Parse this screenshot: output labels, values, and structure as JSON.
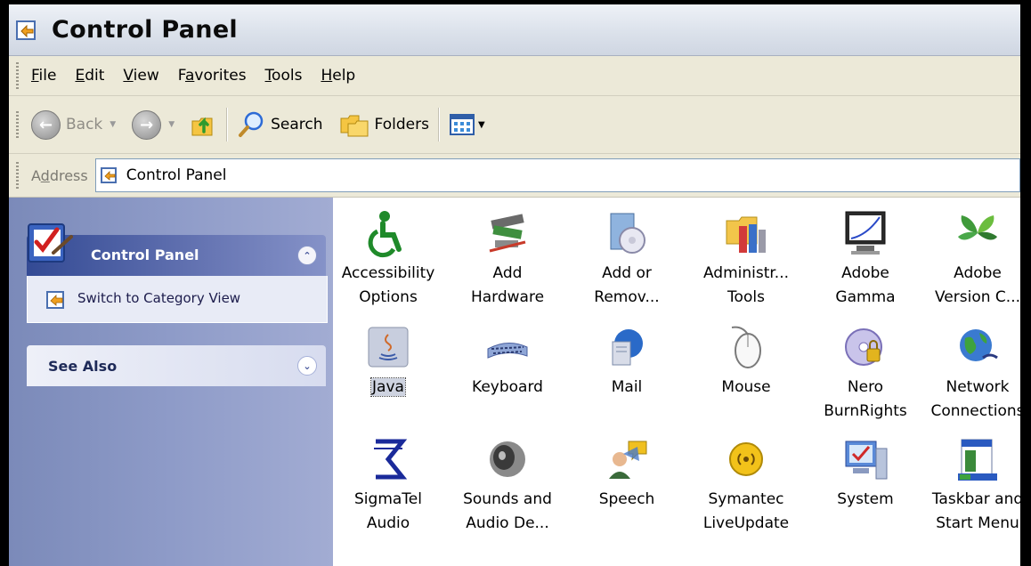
{
  "window": {
    "title": "Control Panel"
  },
  "menu": [
    {
      "label": "File",
      "key": "F",
      "rest": "ile"
    },
    {
      "label": "Edit",
      "key": "E",
      "rest": "dit"
    },
    {
      "label": "View",
      "key": "V",
      "rest": "iew"
    },
    {
      "label": "Favorites",
      "pre": "F",
      "key": "a",
      "rest": "vorites"
    },
    {
      "label": "Tools",
      "key": "T",
      "rest": "ools"
    },
    {
      "label": "Help",
      "key": "H",
      "rest": "elp"
    }
  ],
  "toolbar": {
    "back_label": "Back",
    "search_label": "Search",
    "folders_label": "Folders"
  },
  "address": {
    "label_pre": "A",
    "label_key": "d",
    "label_rest": "dress",
    "value": "Control Panel"
  },
  "taskpane": {
    "control_panel_title": "Control Panel",
    "switch_view_label": "Switch to Category View",
    "see_also_title": "See Also"
  },
  "items": [
    {
      "line1": "Accessibility",
      "line2": "Options",
      "icon": "accessibility-icon"
    },
    {
      "line1": "Add",
      "line2": "Hardware",
      "icon": "add-hardware-icon"
    },
    {
      "line1": "Add or",
      "line2": "Remov...",
      "icon": "add-remove-programs-icon"
    },
    {
      "line1": "Administr...",
      "line2": "Tools",
      "icon": "administrative-tools-icon"
    },
    {
      "line1": "Adobe",
      "line2": "Gamma",
      "icon": "adobe-gamma-icon"
    },
    {
      "line1": "Adobe",
      "line2": "Version C...",
      "icon": "adobe-version-cue-icon"
    },
    {
      "line1": "Java",
      "line2": "",
      "icon": "java-icon",
      "selected": true
    },
    {
      "line1": "Keyboard",
      "line2": "",
      "icon": "keyboard-icon"
    },
    {
      "line1": "Mail",
      "line2": "",
      "icon": "mail-icon"
    },
    {
      "line1": "Mouse",
      "line2": "",
      "icon": "mouse-icon"
    },
    {
      "line1": "Nero",
      "line2": "BurnRights",
      "icon": "nero-burnrights-icon"
    },
    {
      "line1": "Network",
      "line2": "Connections",
      "icon": "network-connections-icon"
    },
    {
      "line1": "SigmaTel",
      "line2": "Audio",
      "icon": "sigmatel-audio-icon"
    },
    {
      "line1": "Sounds and",
      "line2": "Audio De...",
      "icon": "sounds-audio-icon"
    },
    {
      "line1": "Speech",
      "line2": "",
      "icon": "speech-icon"
    },
    {
      "line1": "Symantec",
      "line2": "LiveUpdate",
      "icon": "symantec-liveupdate-icon"
    },
    {
      "line1": "System",
      "line2": "",
      "icon": "system-icon"
    },
    {
      "line1": "Taskbar and",
      "line2": "Start Menu",
      "icon": "taskbar-start-menu-icon"
    }
  ]
}
